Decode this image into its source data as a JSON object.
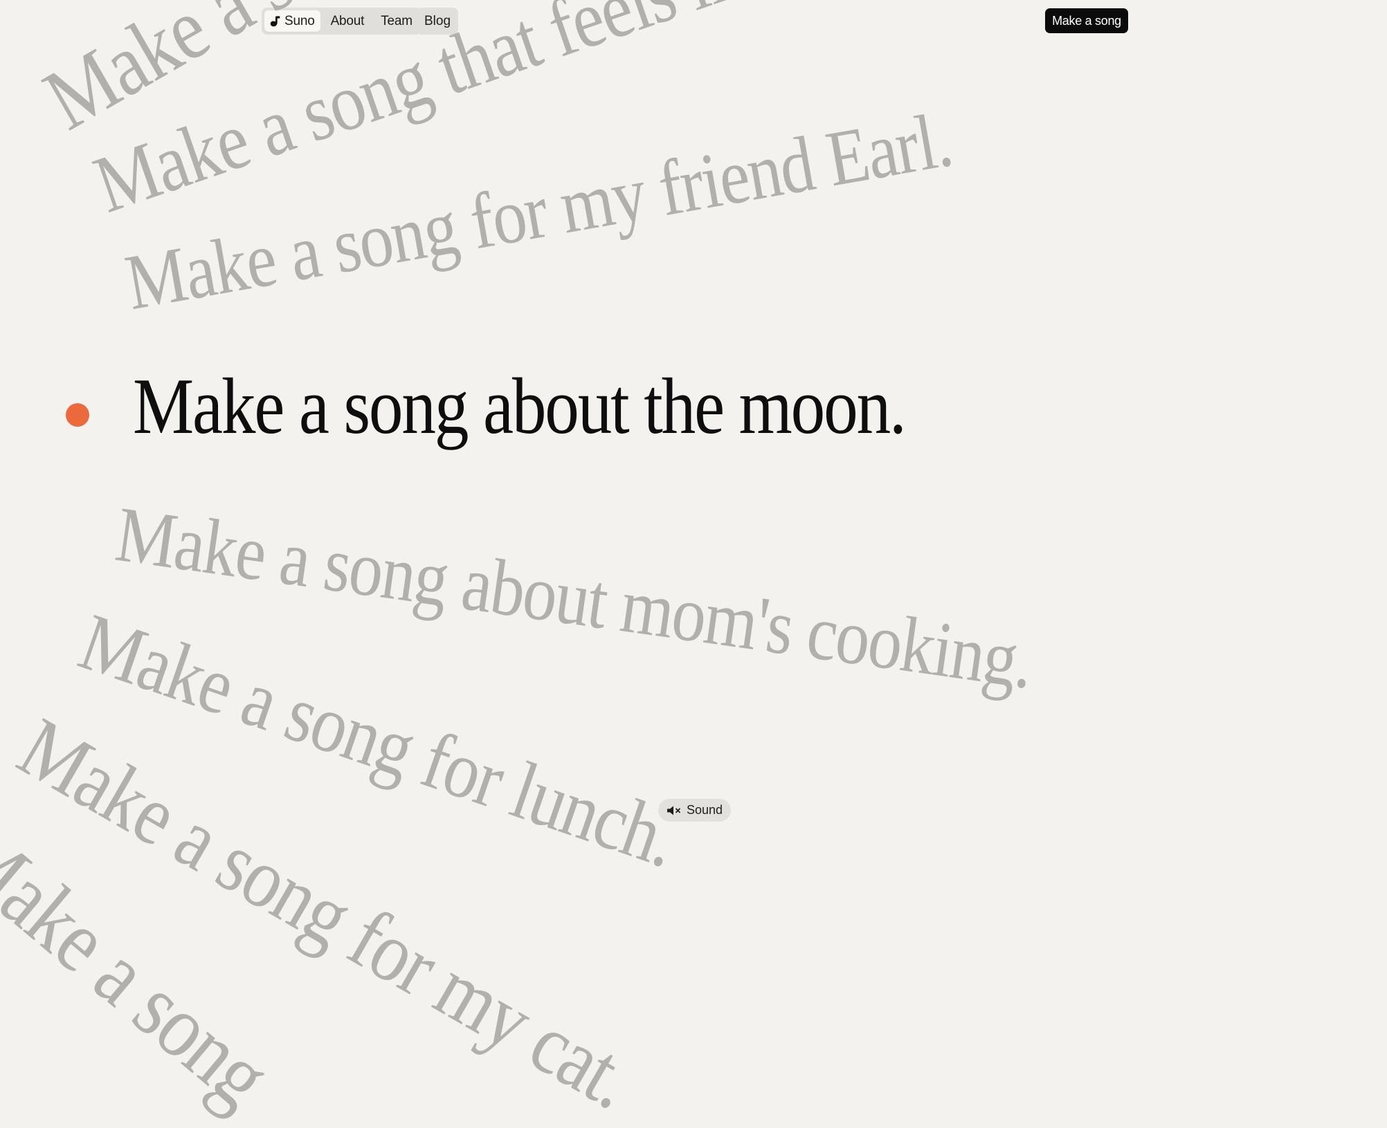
{
  "nav": {
    "brand": "Suno",
    "brand_icon": "suno-logo-icon",
    "items": [
      {
        "label": "About"
      },
      {
        "label": "Team"
      }
    ],
    "blog": "Blog",
    "cta": "Make a song"
  },
  "prompts": {
    "above": [
      "Make a song that feels like spring.",
      "Make a song that feels like spring.",
      "Make a song for my friend Earl."
    ],
    "current": "Make a song about the moon.",
    "below": [
      "Make a song about mom's cooking.",
      "Make a song for lunch.",
      "Make a song for my cat.",
      "Make a song"
    ]
  },
  "indicator_color": "#ea6a3e",
  "sound": {
    "label": "Sound",
    "icon": "speaker-muted-icon",
    "muted": true
  }
}
